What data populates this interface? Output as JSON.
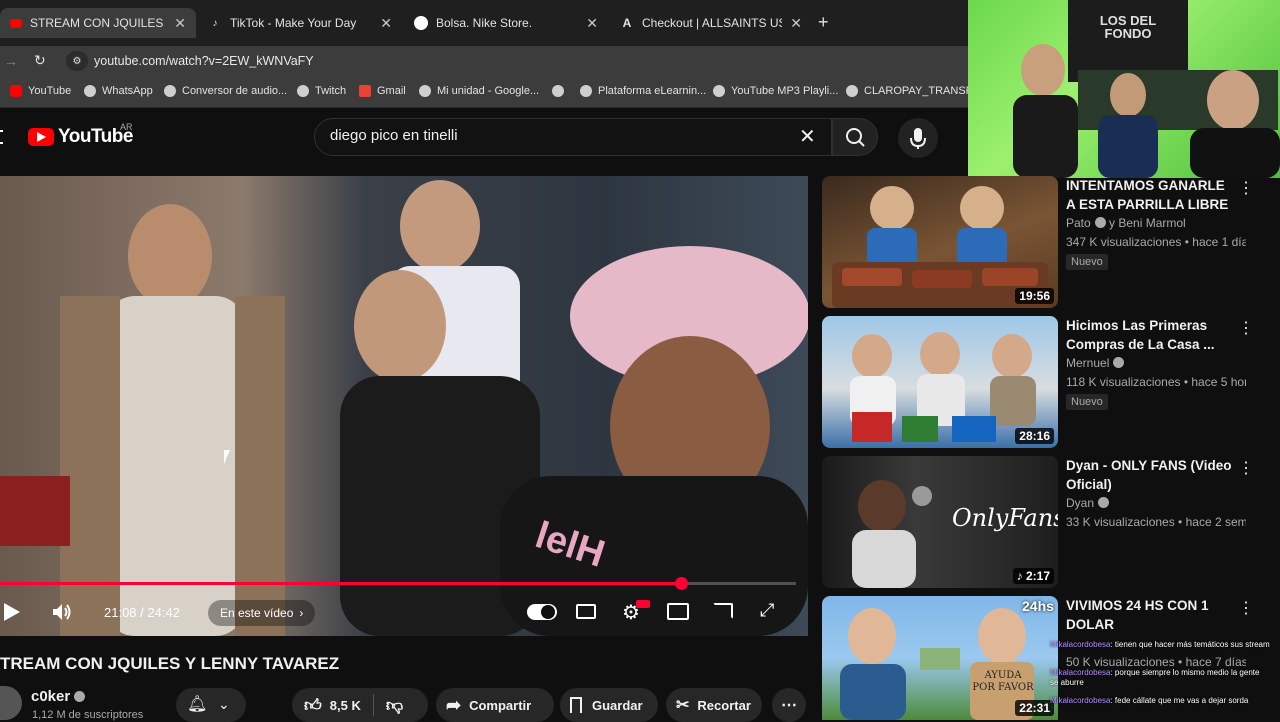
{
  "browser": {
    "tabs": [
      {
        "label": "STREAM CON JQUILES Y LENNY",
        "icon": "youtube-icon",
        "active": true
      },
      {
        "label": "TikTok - Make Your Day",
        "icon": "tiktok-icon"
      },
      {
        "label": "Bolsa. Nike Store.",
        "icon": "nike-icon"
      },
      {
        "label": "Checkout | ALLSAINTS US",
        "icon": "allsaints-icon"
      }
    ],
    "url": "youtube.com/watch?v=2EW_kWNVaFY",
    "bookmarks": [
      {
        "label": "YouTube",
        "color": "#ff0000"
      },
      {
        "label": "WhatsApp",
        "color": "#cfcfcf"
      },
      {
        "label": "Conversor de audio...",
        "color": "#cfcfcf"
      },
      {
        "label": "Twitch",
        "color": "#cfcfcf"
      },
      {
        "label": "Gmail",
        "color": "#ea4335"
      },
      {
        "label": "Mi unidad - Google...",
        "color": "#cfcfcf"
      },
      {
        "label": "",
        "color": "#cfcfcf"
      },
      {
        "label": "Plataforma eLearnin...",
        "color": "#cfcfcf"
      },
      {
        "label": "YouTube MP3 Playli...",
        "color": "#cfcfcf"
      },
      {
        "label": "CLAROPAY_TRANSF...",
        "color": "#cfcfcf"
      }
    ]
  },
  "youtube": {
    "logo_text": "YouTube",
    "region": "AR",
    "search_query": "diego pico en tinelli"
  },
  "player": {
    "time": "21:08 / 24:42",
    "progress": 0.855,
    "chapters_label": "En este vídeo",
    "overlay_text": "lelH"
  },
  "video": {
    "title": "TREAM CON JQUILES Y LENNY TAVAREZ",
    "channel": "c0ker",
    "subscribers": "1,12 M de suscriptores",
    "likes": "8,5 K",
    "share": "Compartir",
    "save": "Guardar",
    "clip": "Recortar"
  },
  "webcam": {
    "banner_text": "LOS DEL FONDO"
  },
  "related": [
    {
      "title": "INTENTAMOS GANARLE A ESTA PARRILLA LIBRE",
      "channel": "Pato",
      "channel_extra": "y Beni Marmol",
      "meta": "347 K visualizaciones • hace 1 día",
      "badge": "Nuevo",
      "duration": "19:56"
    },
    {
      "title": "Hicimos Las Primeras Compras de La Casa ...",
      "channel": "Mernuel",
      "meta": "118 K visualizaciones • hace 5 hor...",
      "badge": "Nuevo",
      "duration": "28:16"
    },
    {
      "title": "Dyan - ONLY FANS (Video Oficial)",
      "channel": "Dyan",
      "meta": "33 K visualizaciones • hace 2 sem...",
      "duration": "2:17",
      "thumb_text": "OnlyFans"
    },
    {
      "title": "VIVIMOS 24 HS CON 1 DOLAR",
      "channel": "",
      "meta": "50 K visualizaciones • hace 7 días",
      "duration": "22:31",
      "thumb_text_a": "24hs",
      "thumb_text_b": "AYUDA POR FAVOR"
    }
  ],
  "chat": [
    {
      "user": "Mikalacordobesa",
      "text": ": tienen que hacer más temáticos sus stream"
    },
    {
      "user": "Mikalacordobesa",
      "text": ": porque siempre lo mismo medio la gente se aburre"
    },
    {
      "user": "Mikalacordobesa",
      "text": ": fede cállate que me vas a dejar sorda"
    }
  ]
}
